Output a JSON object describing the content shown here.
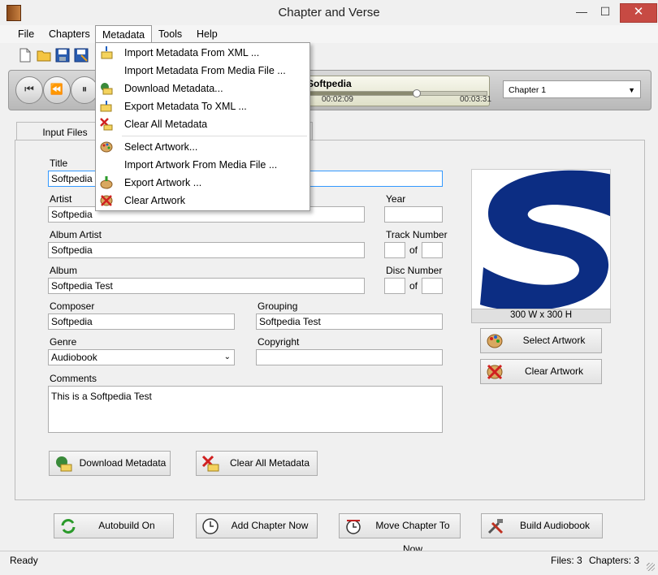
{
  "window": {
    "title": "Chapter and Verse",
    "minimize": "—",
    "maximize": "☐",
    "close": "✕"
  },
  "menubar": {
    "items": [
      "File",
      "Chapters",
      "Metadata",
      "Tools",
      "Help"
    ]
  },
  "metadata_menu": {
    "items": [
      {
        "label": "Import Metadata From XML ...",
        "icon": "tag-import-icon"
      },
      {
        "label": "Import Metadata From Media File ...",
        "icon": "none"
      },
      {
        "label": "Download Metadata...",
        "icon": "tag-download-icon"
      },
      {
        "label": "Export Metadata To XML ...",
        "icon": "tag-export-icon"
      },
      {
        "label": "Clear All Metadata",
        "icon": "tag-clear-icon"
      },
      {
        "label": "Select Artwork...",
        "icon": "palette-icon"
      },
      {
        "label": "Import Artwork From Media File ...",
        "icon": "none"
      },
      {
        "label": "Export Artwork ...",
        "icon": "palette-export-icon"
      },
      {
        "label": "Clear Artwork",
        "icon": "palette-clear-icon"
      }
    ]
  },
  "player": {
    "track_title": "Softpedia",
    "elapsed": "00:02:09",
    "total": "00:03:31",
    "progress": 0.61,
    "chapter": "Chapter 1"
  },
  "tabs": {
    "active": "Input Files"
  },
  "form": {
    "title_label": "Title",
    "title_value": "Softpedia",
    "artist_label": "Artist",
    "artist_value": "Softpedia",
    "year_label": "Year",
    "year_value": "",
    "album_artist_label": "Album Artist",
    "album_artist_value": "Softpedia",
    "track_number_label": "Track Number",
    "of": "of",
    "album_label": "Album",
    "album_value": "Softpedia Test",
    "disc_number_label": "Disc Number",
    "composer_label": "Composer",
    "composer_value": "Softpedia",
    "grouping_label": "Grouping",
    "grouping_value": "Softpedia Test",
    "genre_label": "Genre",
    "genre_value": "Audiobook",
    "copyright_label": "Copyright",
    "copyright_value": "",
    "comments_label": "Comments",
    "comments_value": "This is a Softpedia Test",
    "download_button": "Download Metadata",
    "clear_button": "Clear All Metadata"
  },
  "artwork": {
    "size_label": "300 W x 300 H",
    "select_button": "Select Artwork",
    "clear_button": "Clear Artwork",
    "logo_color": "#0c2d83"
  },
  "bottom_buttons": {
    "autobuild": "Autobuild On",
    "add_chapter": "Add Chapter Now",
    "move_chapter": "Move Chapter To Now",
    "build": "Build Audiobook"
  },
  "status": {
    "text": "Ready",
    "files": "Files: 3",
    "chapters": "Chapters: 3"
  }
}
